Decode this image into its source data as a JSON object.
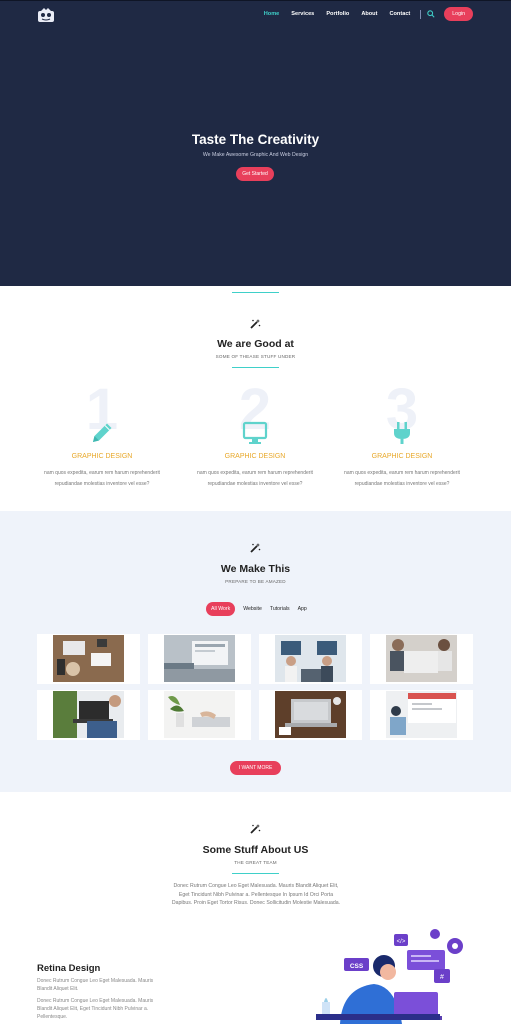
{
  "nav": {
    "links": [
      "Home",
      "Services",
      "Portfolio",
      "About",
      "Contact"
    ],
    "active": "Home",
    "login": "Login"
  },
  "hero": {
    "title": "Taste The Creativity",
    "subtitle": "We Make Awesome Graphic And Web Design",
    "button": "Get Started"
  },
  "good_at": {
    "title": "We are Good at",
    "subtitle": "SOME OF THEASE STUFF UNDER",
    "features": [
      {
        "number": "1",
        "icon": "pencil-icon",
        "title": "GRAPHIC DESIGN",
        "text": "nam quos expedita, earum rem harum reprehenderit repudiandae molestias inventore vel esse?"
      },
      {
        "number": "2",
        "icon": "monitor-icon",
        "title": "GRAPHIC DESIGN",
        "text": "nam quos expedita, earum rem harum reprehenderit repudiandae molestias inventore vel esse?"
      },
      {
        "number": "3",
        "icon": "plug-icon",
        "title": "GRAPHIC DESIGN",
        "text": "nam quos expedita, earum rem harum reprehenderit repudiandae molestias inventore vel esse?"
      }
    ]
  },
  "portfolio": {
    "title": "We Make This",
    "subtitle": "PREPARE TO BE AMAZED",
    "filters": [
      "All Work",
      "Website",
      "Tutorials",
      "App"
    ],
    "active_filter": "All Work",
    "more_button": "I WANT MORE"
  },
  "about": {
    "title": "Some Stuff About US",
    "subtitle": "THE GREAT TEAM",
    "text": "Donec Rutrum Congue Leo Eget Malesuada. Mauris Blandit Aliquet Elit, Eget Tincidunt Nibh Pulvinar a. Pellentesque In Ipsum Id Orci Porta Dapibus. Proin Eget Tortor Risus. Donec Sollicitudin Molestie Malesuada.",
    "retina_title": "Retina Design",
    "retina_p1": "Donec Rutrum Congue Leo Eget Malesuada. Mauris Blandit Aliquet Elit.",
    "retina_p2": "Donec Rutrum Congue Leo Eget Malesuada. Mauris Blandit Aliquet Elit, Eget Tincidunt Nibh Pulvinar a. Pellentesque."
  },
  "illustration": {
    "badge_css": "CSS",
    "badge_code": "</>",
    "badge_hash": "#"
  },
  "colors": {
    "hero_bg": "#1f2944",
    "accent_teal": "#3fd0c9",
    "accent_red": "#e83f5b",
    "feature_yellow": "#e8a82a",
    "portfolio_bg": "#eff3fa",
    "illustration_purple": "#6b3fc9"
  }
}
